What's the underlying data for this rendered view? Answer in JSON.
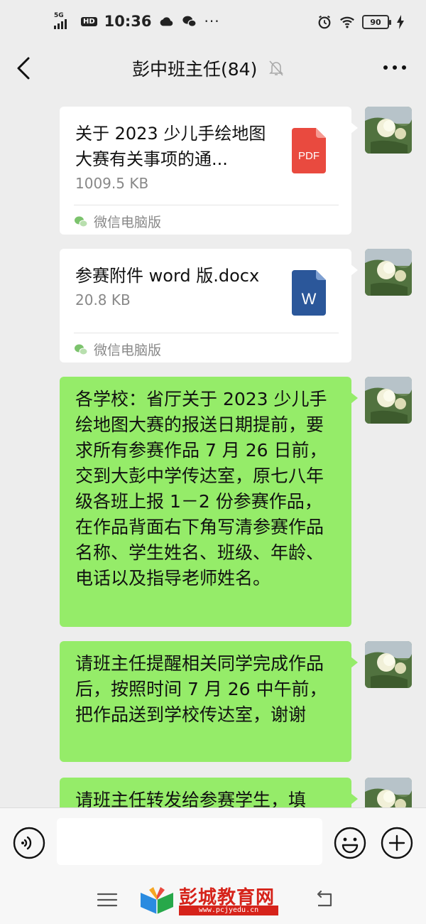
{
  "status_bar": {
    "network": "5G",
    "hd": "HD",
    "time": "10:36",
    "more": "···",
    "battery": "90"
  },
  "header": {
    "title": "彭中班主任(84)"
  },
  "messages": [
    {
      "type": "file",
      "filename": "关于 2023 少儿手绘地图大赛有关事项的通...",
      "size": "1009.5 KB",
      "file_icon": "pdf-icon",
      "file_icon_label": "PDF",
      "source": "微信电脑版"
    },
    {
      "type": "file",
      "filename": "参赛附件 word 版.docx",
      "size": "20.8 KB",
      "file_icon": "word-icon",
      "file_icon_label": "W",
      "source": "微信电脑版"
    },
    {
      "type": "text",
      "text": "各学校：省厅关于 2023 少儿手绘地图大赛的报送日期提前，要求所有参赛作品 7 月 26 日前，交到大彭中学传达室，原七八年级各班上报 1－2 份参赛作品，在作品背面右下角写清参赛作品名称、学生姓名、班级、年龄、电话以及指导老师姓名。"
    },
    {
      "type": "text",
      "text": "请班主任提醒相关同学完成作品后，按照时间 7 月 26 中午前，把作品送到学校传达室，谢谢"
    },
    {
      "type": "text",
      "text": "请班主任转发给参赛学生，填"
    }
  ],
  "watermark": {
    "name": "彭城教育网",
    "url": "www.pcjyedu.cn"
  },
  "colors": {
    "background": "#ededed",
    "bubble_green": "#95ec69",
    "pdf_red": "#e94a3f",
    "word_blue": "#2b579a"
  }
}
